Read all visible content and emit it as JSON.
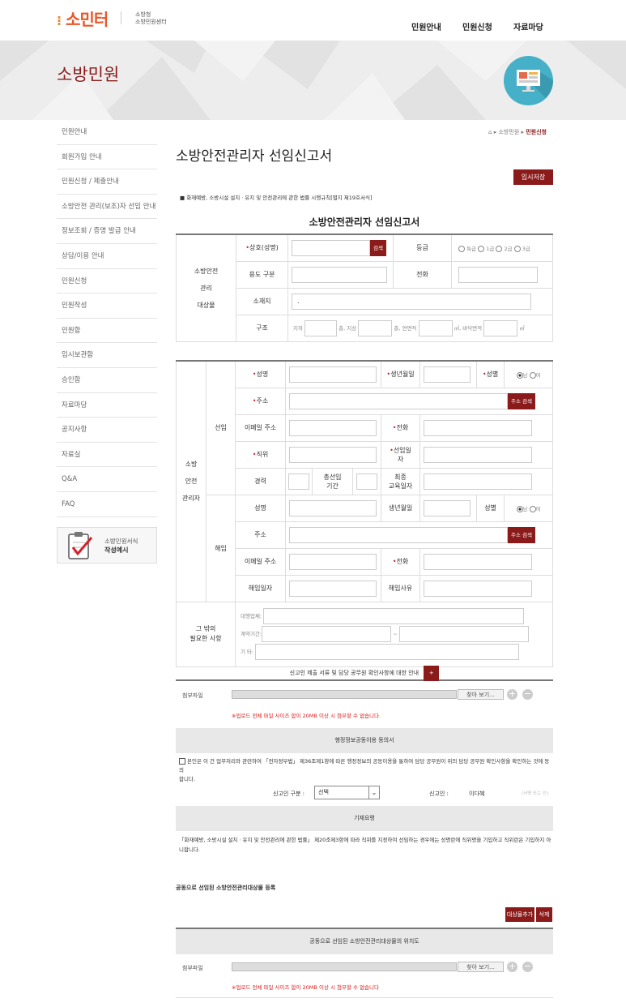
{
  "header": {
    "logo": "소민터",
    "logo_sub1": "소방청",
    "logo_sub2": "소방민원센터",
    "nav": [
      "민원안내",
      "민원신청",
      "자료마당"
    ]
  },
  "banner": {
    "title": "소방민원"
  },
  "sidebar": {
    "items": [
      "민원안내",
      "회원가입 안내",
      "민원신청 / 제출안내",
      "소방안전 관리(보조)자 선임 안내",
      "정보조회 / 증명 발급 안내",
      "상담/이용 안내",
      "민원신청",
      "민원작성",
      "민원함",
      "임시보관함",
      "승인함",
      "자료마당",
      "공지사항",
      "자료실",
      "Q&A",
      "FAQ"
    ],
    "example_line1": "소방민원서식",
    "example_line2": "작성예시"
  },
  "breadcrumb": {
    "home": "⌂",
    "sep": "▸",
    "mid": "소방민원",
    "cur": "민원신청"
  },
  "page": {
    "title": "소방안전관리자 선임신고서",
    "temp_save": "임시저장",
    "law": "■ 화재예방, 소방시설 설치ㆍ유지 및 안전관리에 관한 법률 시행규칙[별지 제19호서식]",
    "form_title": "소방안전관리자 선임신고서"
  },
  "target": {
    "section": [
      "소방안전",
      "관리",
      "대상물"
    ],
    "name_label": "상호(성명)",
    "search": "검색",
    "grade_label": "등급",
    "grades": [
      "특급",
      "1급",
      "2급",
      "3급"
    ],
    "use_label": "용도 구분",
    "phone_label": "전화",
    "addr_label": "소재지",
    "addr_value": ".",
    "struct_label": "구조",
    "under": "지하",
    "floor1": "층, 지상",
    "floor2": "층, 연면적",
    "area1": "㎡, 바닥면적",
    "area2": "㎡"
  },
  "manager": {
    "section": [
      "소방",
      "안전",
      "관리자"
    ],
    "appoint": "선임",
    "dismiss": "해임",
    "name": "성명",
    "birth": "생년월일",
    "gender": "성별",
    "male": "남",
    "female": "여",
    "addr": "주소",
    "addr_search": "주소 검색",
    "email": "이메일 주소",
    "phone": "전화",
    "position": "직위",
    "appoint_date1": "선임일",
    "appoint_date2": "자",
    "career": "경력",
    "total1": "총선임",
    "total2": "기간",
    "edu1": "최종",
    "edu2": "교육일자",
    "dismiss_date": "해임일자",
    "dismiss_reason": "해임사유"
  },
  "other": {
    "label1": "그 밖의",
    "label2": "필요한 사항",
    "agency": "대행업체:",
    "period": "계약기간:",
    "etc": "기 타:",
    "dash": "~"
  },
  "notice": {
    "text": "신고인 제출 서류 및 담당 공무원 확인사항에 대한 안내",
    "plus": "+"
  },
  "attach": {
    "label": "첨부파일",
    "browse": "찾아 보기...",
    "warn": "※업로드 전체 파일 사이즈 합이 20MB 이상 시 첨부할 수 없습니다."
  },
  "consent": {
    "title": "행정정보공동이용 동의서",
    "text1": "본인은 이 건 업무처리와 관련하여 「전자정부법」 제36조제1항에 따른 행정정보의 공동이용을 통하여 담당 공무원이 위의 담당 공무원 확인사항을 확인하는 것에 동의",
    "text2": "합니다.",
    "type_label": "신고인 구분 :",
    "type_value": "선택",
    "applicant_label": "신고인 :",
    "applicant_value": "이다혜",
    "sign": "(서명 또는 인)"
  },
  "guide": {
    "title": "기재요령",
    "text1": "「화재예방, 소방시설 설치ㆍ유지 및 안전관리에 관한 법률」 제20조제3항에 따라 직위를 지정하여 선임하는 경우에는 성명란에 직위명을 기입하고 직위란은 기입하지 아",
    "text2": "니합니다."
  },
  "joint": {
    "title": "공동으로 선임된 소방안전관리대상물 등록",
    "add": "대상물추가",
    "del": "삭제",
    "bar": "공동으로 선임된 소방안전관리대상물의 위치도",
    "warn": "※업로드 전체 파일 사이즈 합이 20MB 이상 시 첨부할 수 없습니다"
  }
}
